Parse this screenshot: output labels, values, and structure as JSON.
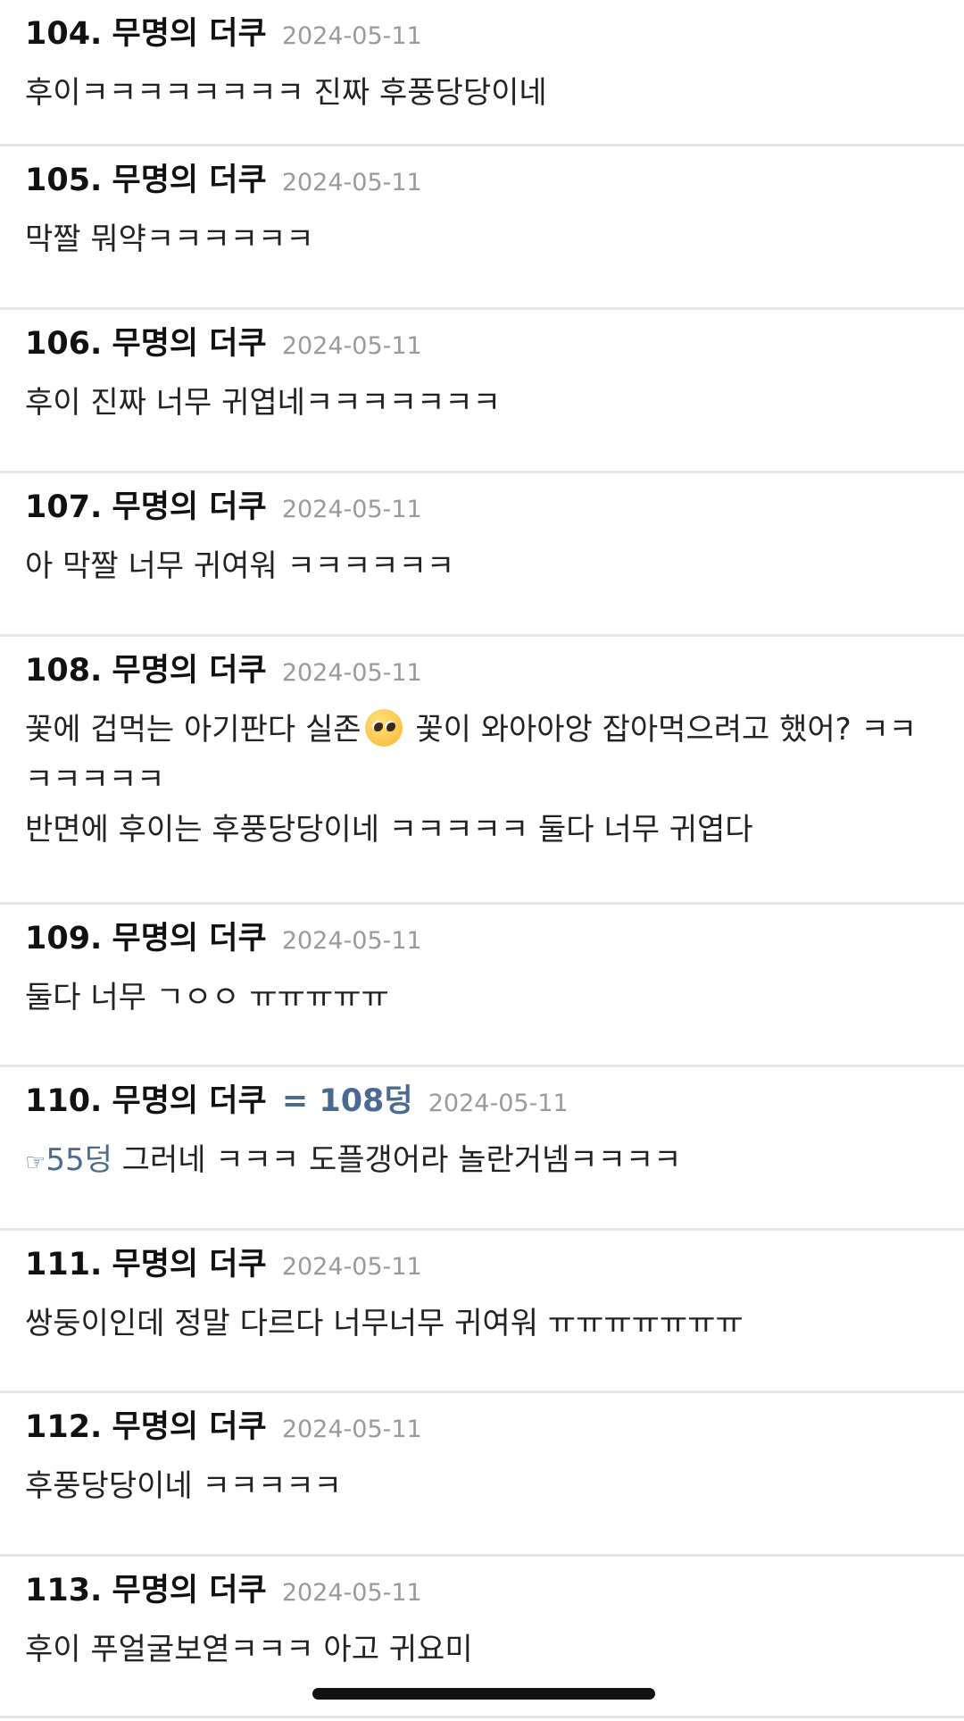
{
  "comments": [
    {
      "num": "104.",
      "author": "무명의 더쿠",
      "date": "2024-05-11",
      "lines": [
        "후이ㅋㅋㅋㅋㅋㅋㅋㅋ 진짜 후풍당당이네"
      ]
    },
    {
      "num": "105.",
      "author": "무명의 더쿠",
      "date": "2024-05-11",
      "lines": [
        "막짤 뭐약ㅋㅋㅋㅋㅋㅋ"
      ]
    },
    {
      "num": "106.",
      "author": "무명의 더쿠",
      "date": "2024-05-11",
      "lines": [
        "후이 진짜 너무 귀엽네ㅋㅋㅋㅋㅋㅋㅋ"
      ]
    },
    {
      "num": "107.",
      "author": "무명의 더쿠",
      "date": "2024-05-11",
      "lines": [
        "아 막짤 너무 귀여워 ㅋㅋㅋㅋㅋㅋ"
      ]
    },
    {
      "num": "108.",
      "author": "무명의 더쿠",
      "date": "2024-05-11",
      "line1_pre": "꽃에 겁먹는 아기판다 실존",
      "emoji_name": "pleading-face-icon",
      "line1_post": " 꽃이 와아아앙 잡아먹으려고 했어? ㅋㅋㅋㅋㅋㅋㅋ",
      "line2": "반면에 후이는 후풍당당이네 ㅋㅋㅋㅋㅋ 둘다 너무 귀엽다"
    },
    {
      "num": "109.",
      "author": "무명의 더쿠",
      "date": "2024-05-11",
      "lines": [
        "둘다 너무 ㄱㅇㅇ ㅠㅠㅠㅠㅠ"
      ]
    },
    {
      "num": "110.",
      "author": "무명의 더쿠",
      "reply_to": "= 108덩",
      "date": "2024-05-11",
      "quote_hand": "☞",
      "quote_ref": "55덩",
      "text": " 그러네 ㅋㅋㅋ 도플갱어라 놀란거넴ㅋㅋㅋㅋ"
    },
    {
      "num": "111.",
      "author": "무명의 더쿠",
      "date": "2024-05-11",
      "lines": [
        "쌍둥이인데 정말 다르다 너무너무 귀여워 ㅠㅠㅠㅠㅠㅠㅠ"
      ]
    },
    {
      "num": "112.",
      "author": "무명의 더쿠",
      "date": "2024-05-11",
      "lines": [
        "후풍당당이네 ㅋㅋㅋㅋㅋ"
      ]
    },
    {
      "num": "113.",
      "author": "무명의 더쿠",
      "date": "2024-05-11",
      "lines": [
        "후이 푸얼굴보엳ㅋㅋㅋ 아고 귀요미"
      ]
    }
  ],
  "colors": {
    "divider": "#e6e6e6",
    "link": "#4a6a8f",
    "date": "#9a9a9a"
  }
}
